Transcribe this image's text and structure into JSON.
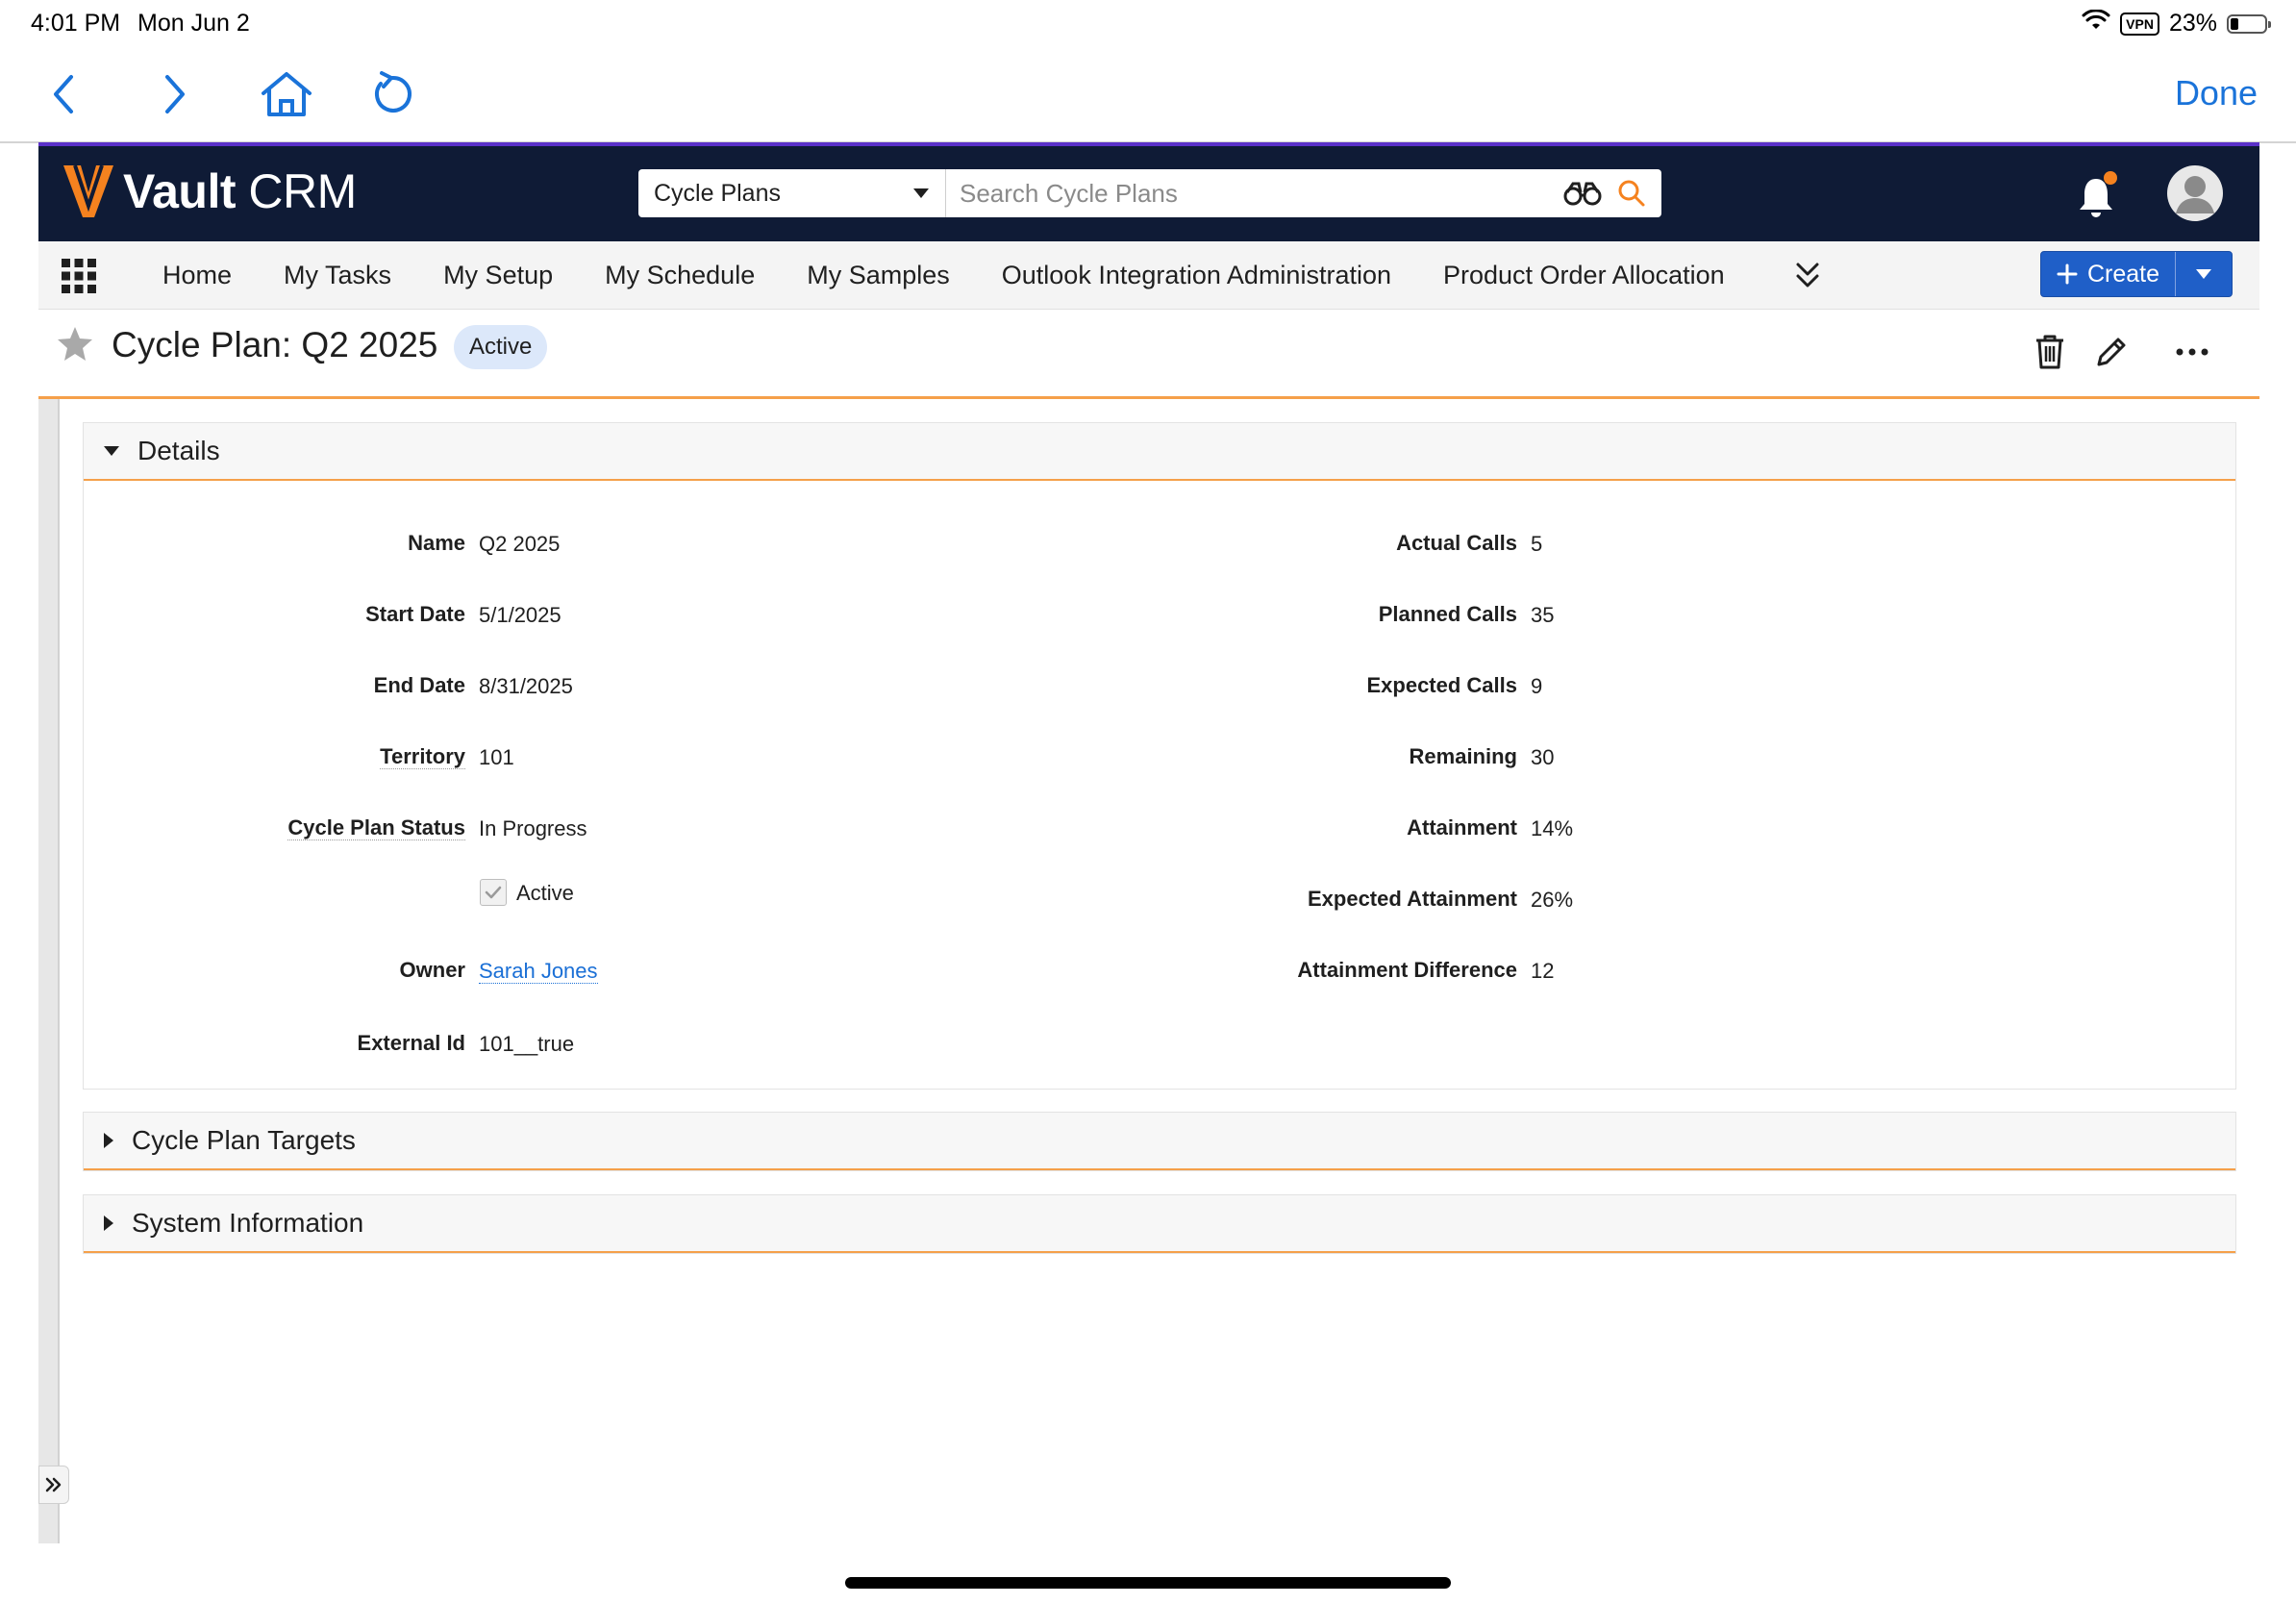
{
  "status_bar": {
    "time": "4:01 PM",
    "date": "Mon Jun 2",
    "vpn": "VPN",
    "battery": "23%",
    "battery_level": 0.23
  },
  "browser": {
    "back_icon": "chevron-left-icon",
    "forward_icon": "chevron-right-icon",
    "home_icon": "home-icon",
    "reload_icon": "reload-icon",
    "done_label": "Done",
    "accent": "#1a73d9"
  },
  "app": {
    "logo_bold": "Vault",
    "logo_light": " CRM",
    "header_color": "#0f1b36",
    "accent_purple": "#5a31c8",
    "brand_orange": "#f5821f"
  },
  "search": {
    "object_selected": "Cycle Plans",
    "placeholder": "Search Cycle Plans"
  },
  "nav": {
    "items": [
      "Home",
      "My Tasks",
      "My Setup",
      "My Schedule",
      "My Samples",
      "Outlook Integration Administration",
      "Product Order Allocation"
    ],
    "create_label": "Create",
    "create_color": "#1f5fc8"
  },
  "record": {
    "title": "Cycle Plan: Q2 2025",
    "status": "Active"
  },
  "sections": {
    "details": "Details",
    "targets": "Cycle Plan Targets",
    "system": "System Information"
  },
  "fields_left": [
    {
      "label": "Name",
      "value": "Q2 2025"
    },
    {
      "label": "Start Date",
      "value": "5/1/2025"
    },
    {
      "label": "End Date",
      "value": "8/31/2025"
    },
    {
      "label": "Territory",
      "value": "101"
    },
    {
      "label": "Cycle Plan Status",
      "value": "In Progress"
    },
    {
      "label": "",
      "value": "Active",
      "checkbox": true,
      "checked": true
    },
    {
      "label": "Owner",
      "value": "Sarah Jones",
      "link": true
    },
    {
      "label": "External Id",
      "value": "101__true"
    }
  ],
  "fields_right": [
    {
      "label": "Actual Calls",
      "value": "5"
    },
    {
      "label": "Planned Calls",
      "value": "35"
    },
    {
      "label": "Expected Calls",
      "value": "9"
    },
    {
      "label": "Remaining",
      "value": "30"
    },
    {
      "label": "Attainment",
      "value": "14%"
    },
    {
      "label": "Expected Attainment",
      "value": "26%"
    },
    {
      "label": "Attainment Difference",
      "value": "12"
    }
  ]
}
